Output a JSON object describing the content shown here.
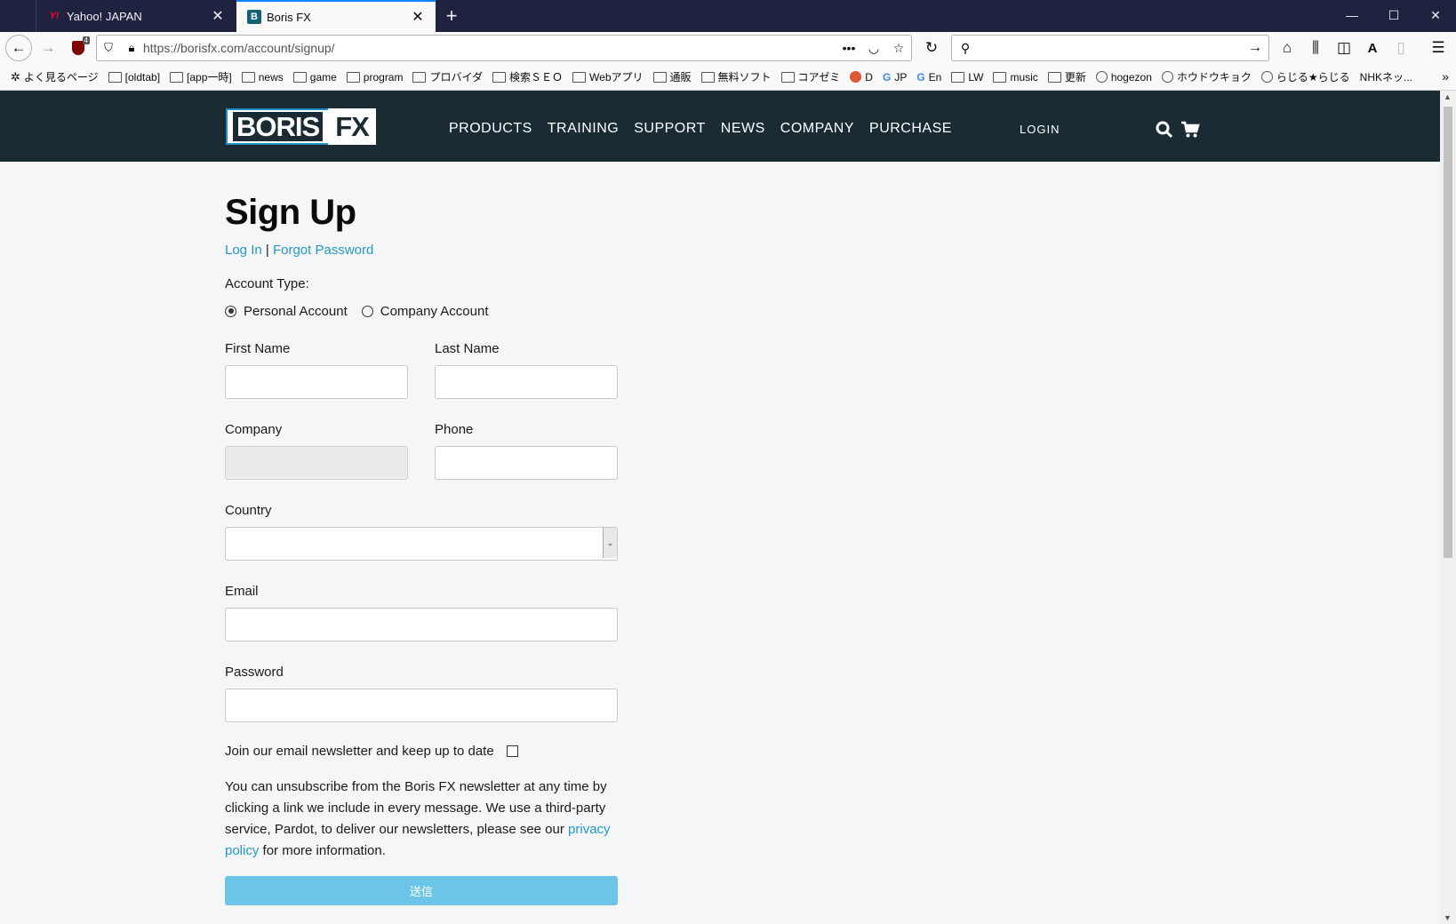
{
  "tabs": [
    {
      "title": "Yahoo! JAPAN",
      "icon": "yahoo-favicon",
      "active": false
    },
    {
      "title": "Boris FX",
      "icon": "borisfx-favicon",
      "active": true
    }
  ],
  "toolbar": {
    "url": "https://borisfx.com/account/signup/",
    "ublock_badge": "4",
    "search_placeholder": ""
  },
  "bookmarks": [
    {
      "label": "よく見るページ",
      "icon": "gear-icon"
    },
    {
      "label": "[oldtab]",
      "icon": "folder-icon"
    },
    {
      "label": "[app一時]",
      "icon": "folder-icon"
    },
    {
      "label": "news",
      "icon": "folder-icon"
    },
    {
      "label": "game",
      "icon": "folder-icon"
    },
    {
      "label": "program",
      "icon": "folder-icon"
    },
    {
      "label": "プロバイダ",
      "icon": "folder-icon"
    },
    {
      "label": "検索ＳＥＯ",
      "icon": "folder-icon"
    },
    {
      "label": "Webアプリ",
      "icon": "folder-icon"
    },
    {
      "label": "通販",
      "icon": "folder-icon"
    },
    {
      "label": "無料ソフト",
      "icon": "folder-icon"
    },
    {
      "label": "コアゼミ",
      "icon": "folder-icon"
    },
    {
      "label": "D",
      "icon": "duckduckgo-icon"
    },
    {
      "label": "JP",
      "icon": "google-icon"
    },
    {
      "label": "En",
      "icon": "google-icon"
    },
    {
      "label": "LW",
      "icon": "folder-icon"
    },
    {
      "label": "music",
      "icon": "folder-icon"
    },
    {
      "label": "更新",
      "icon": "folder-icon"
    },
    {
      "label": "hogezon",
      "icon": "globe-icon"
    },
    {
      "label": "ホウドウキョク",
      "icon": "globe-icon"
    },
    {
      "label": "らじる★らじる",
      "icon": "globe-icon"
    },
    {
      "label": "NHKネッ...",
      "icon": "none"
    }
  ],
  "site": {
    "logo_left": "BORIS",
    "logo_right": "FX",
    "nav": [
      "PRODUCTS",
      "TRAINING",
      "SUPPORT",
      "NEWS",
      "COMPANY",
      "PURCHASE"
    ],
    "login": "LOGIN"
  },
  "form": {
    "title": "Sign Up",
    "login_link": "Log In",
    "separator": "|",
    "forgot_link": "Forgot Password",
    "account_type_label": "Account Type:",
    "account_types": [
      {
        "label": "Personal Account",
        "selected": true
      },
      {
        "label": "Company Account",
        "selected": false
      }
    ],
    "first_name_label": "First Name",
    "last_name_label": "Last Name",
    "company_label": "Company",
    "phone_label": "Phone",
    "country_label": "Country",
    "country_value": "",
    "email_label": "Email",
    "password_label": "Password",
    "newsletter_label": "Join our email newsletter and keep up to date",
    "newsletter_checked": false,
    "disclaimer_before": "You can unsubscribe from the Boris FX newsletter at any time by clicking a link we include in every message. We use a third-party service, Pardot, to deliver our newsletters, please see our ",
    "privacy_link": "privacy policy",
    "disclaimer_after": " for more information.",
    "submit": "送信"
  },
  "colors": {
    "header_bg": "#1a2b33",
    "link": "#2299cc",
    "submit_bg": "#6cc4e6",
    "tabstrip_bg": "#202340"
  }
}
